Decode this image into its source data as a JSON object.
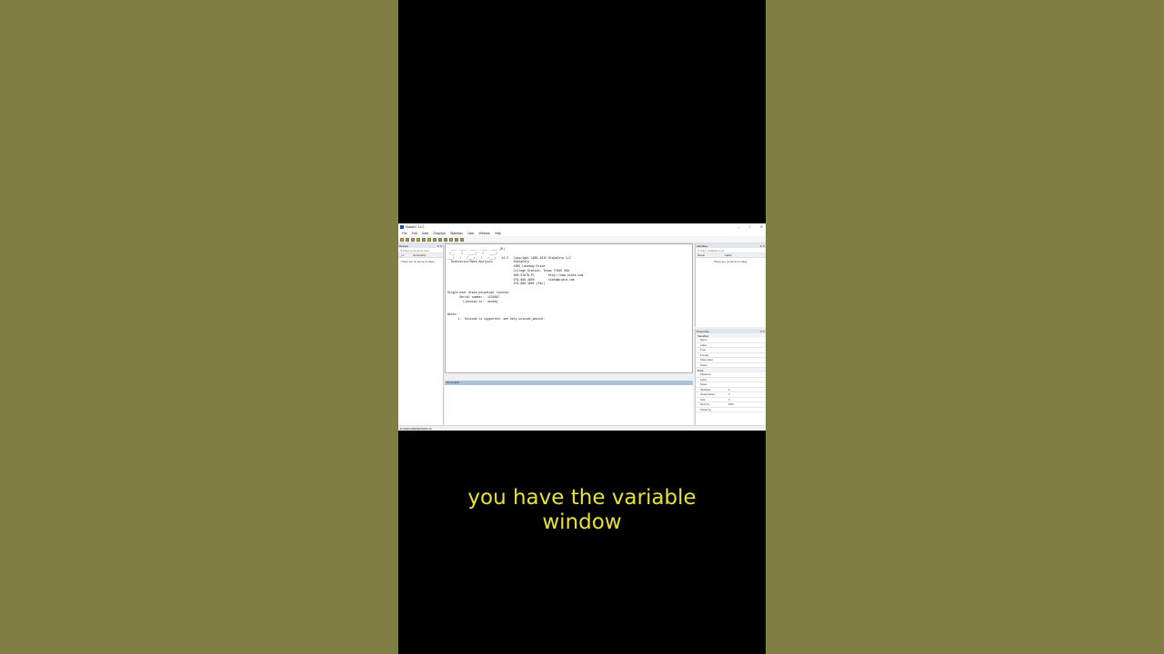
{
  "window": {
    "title": "Stata/IC 14.2",
    "controls": [
      "–",
      "□",
      "✕"
    ]
  },
  "menu": [
    "File",
    "Edit",
    "Data",
    "Graphics",
    "Statistics",
    "User",
    "Window",
    "Help"
  ],
  "review": {
    "title": "Review",
    "filter_placeholder": "Filter commands here",
    "column": "Command",
    "empty": "There are no items to show."
  },
  "results": {
    "text": "  ___  ____  ____  ____  ____ (R)\n /__    /   ____/   /   ____/\n___/   /   /___/   /   /___/   14.2   Copyright 1985-2015 StataCorp LLC\n  Statistics/Data Analysis            StataCorp\n                                      4905 Lakeway Drive\n                                      College Station, Texas 77845 USA\n                                      800-STATA-PC        http://www.stata.com\n                                      979-696-4600        stata@stata.com\n                                      979-696-4601 (fax)\n\nSingle-user Stata perpetual license:\n       Serial number:  1234567\n         Licensed to:  donkey\n\n\nNotes:\n      1.  Unicode is supported; see help unicode_advice."
  },
  "command": {
    "title": "Command"
  },
  "variables": {
    "title": "Variables",
    "filter_placeholder": "Filter variables here",
    "col_name": "Name",
    "col_label": "Label",
    "empty": "There are no items to show."
  },
  "properties": {
    "title": "Properties",
    "sections": [
      {
        "name": "Variables",
        "rows": [
          {
            "k": "Name",
            "v": ""
          },
          {
            "k": "Label",
            "v": ""
          },
          {
            "k": "Type",
            "v": ""
          },
          {
            "k": "Format",
            "v": ""
          },
          {
            "k": "Value label",
            "v": ""
          },
          {
            "k": "Notes",
            "v": ""
          }
        ]
      },
      {
        "name": "Data",
        "rows": [
          {
            "k": "Filename",
            "v": ""
          },
          {
            "k": "Label",
            "v": ""
          },
          {
            "k": "Notes",
            "v": ""
          },
          {
            "k": "Variables",
            "v": "0"
          },
          {
            "k": "Observations",
            "v": "0"
          },
          {
            "k": "Size",
            "v": "0"
          },
          {
            "k": "Memory",
            "v": "64M"
          },
          {
            "k": "Sorted by",
            "v": ""
          }
        ]
      }
    ]
  },
  "status": "D:\\SOFTWARE\\STATA 14",
  "caption": {
    "line1": "you have the variable",
    "line2": "window"
  }
}
